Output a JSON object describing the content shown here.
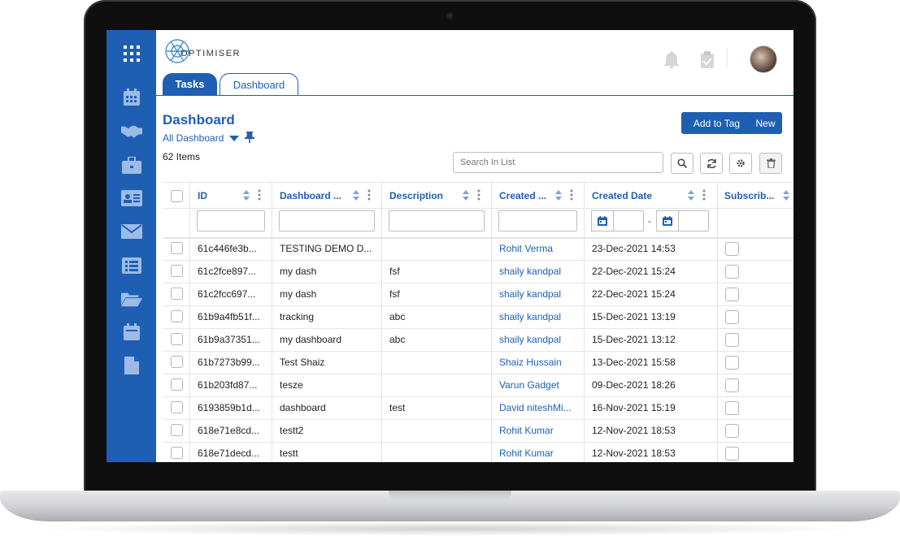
{
  "app": {
    "logo_text": "OPTIMISER"
  },
  "tabs": [
    {
      "label": "Tasks",
      "active": false
    },
    {
      "label": "Dashboard",
      "active": true
    }
  ],
  "page": {
    "title": "Dashboard",
    "view_selector": "All Dashboard",
    "item_count": "62 Items"
  },
  "actions": {
    "add_to_tag": "Add to Tag",
    "new": "New"
  },
  "search": {
    "placeholder": "Search In List"
  },
  "columns": [
    "ID",
    "Dashboard ...",
    "Description",
    "Created ...",
    "Created Date",
    "Subscrib..."
  ],
  "filters": {
    "date_separator": "-"
  },
  "rows": [
    {
      "id": "61c446fe3b...",
      "name": "TESTING DEMO D...",
      "description": "",
      "created_by": "Rohit Verma",
      "created_date": "23-Dec-2021 14:53"
    },
    {
      "id": "61c2fce897...",
      "name": "my dash",
      "description": "fsf",
      "created_by": "shaily kandpal",
      "created_date": "22-Dec-2021 15:24"
    },
    {
      "id": "61c2fcc697...",
      "name": "my dash",
      "description": "fsf",
      "created_by": "shaily kandpal",
      "created_date": "22-Dec-2021 15:24"
    },
    {
      "id": "61b9a4fb51f...",
      "name": "tracking",
      "description": "abc",
      "created_by": "shaily kandpal",
      "created_date": "15-Dec-2021 13:19"
    },
    {
      "id": "61b9a37351...",
      "name": "my dashboard",
      "description": "abc",
      "created_by": "shaily kandpal",
      "created_date": "15-Dec-2021 13:12"
    },
    {
      "id": "61b7273b99...",
      "name": "Test Shaiz",
      "description": "",
      "created_by": "Shaiz Hussain",
      "created_date": "13-Dec-2021 15:58"
    },
    {
      "id": "61b203fd87...",
      "name": "tesze",
      "description": "",
      "created_by": "Varun Gadget",
      "created_date": "09-Dec-2021 18:26"
    },
    {
      "id": "6193859b1d...",
      "name": "dashboard",
      "description": "test",
      "created_by": "David niteshMi...",
      "created_date": "16-Nov-2021 15:19"
    },
    {
      "id": "618e71e8cd...",
      "name": "testt2",
      "description": "",
      "created_by": "Rohit Kumar",
      "created_date": "12-Nov-2021 18:53"
    },
    {
      "id": "618e71decd...",
      "name": "testt",
      "description": "",
      "created_by": "Rohit Kumar",
      "created_date": "12-Nov-2021 18:53"
    }
  ],
  "sidebar": {
    "icons": [
      "apps-grid-icon",
      "calendar-icon",
      "handshake-icon",
      "briefcase-icon",
      "contact-card-icon",
      "mail-icon",
      "list-icon",
      "folder-open-icon",
      "calendar-small-icon",
      "document-icon"
    ]
  },
  "header_icons": [
    "bell-icon",
    "clipboard-check-icon",
    "user-avatar"
  ],
  "colors": {
    "brand": "#1f5fb3",
    "sidebar": "#1f5fb3",
    "border": "#e3e3e3"
  }
}
